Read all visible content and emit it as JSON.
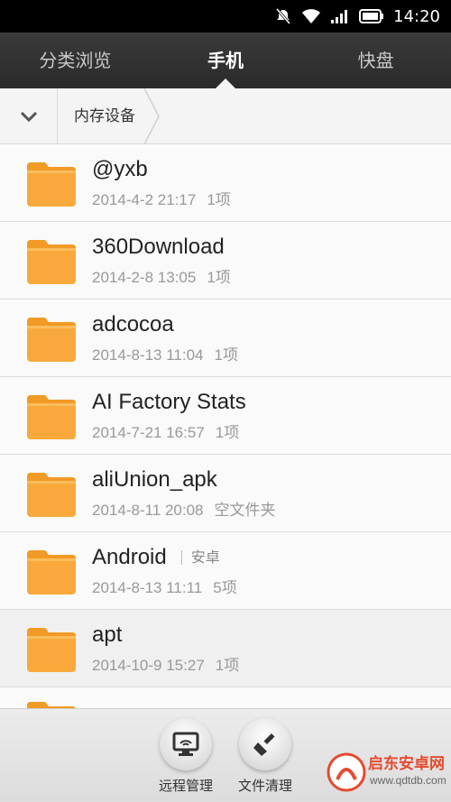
{
  "status": {
    "time": "14:20",
    "icons": [
      "mute-icon",
      "wifi-icon",
      "signal-icon",
      "battery-icon"
    ]
  },
  "tabs": [
    {
      "label": "分类浏览"
    },
    {
      "label": "手机"
    },
    {
      "label": "快盘"
    }
  ],
  "active_tab": "手机",
  "path": {
    "crumb": "内存设备"
  },
  "files": [
    {
      "name": "@yxb",
      "date": "2014-4-2 21:17",
      "count": "1项",
      "alias": ""
    },
    {
      "name": "360Download",
      "date": "2014-2-8 13:05",
      "count": "1项",
      "alias": ""
    },
    {
      "name": "adcocoa",
      "date": "2014-8-13 11:04",
      "count": "1项",
      "alias": ""
    },
    {
      "name": "AI Factory Stats",
      "date": "2014-7-21 16:57",
      "count": "1项",
      "alias": ""
    },
    {
      "name": "aliUnion_apk",
      "date": "2014-8-11 20:08",
      "count": "空文件夹",
      "alias": ""
    },
    {
      "name": "Android",
      "date": "2014-8-13 11:11",
      "count": "5项",
      "alias": "安卓"
    },
    {
      "name": "apt",
      "date": "2014-10-9 15:27",
      "count": "1项",
      "alias": ""
    }
  ],
  "toolbar": {
    "remote": "远程管理",
    "clean": "文件清理"
  },
  "watermark": {
    "text": "启东安卓网",
    "url": "www.qdtdb.com"
  },
  "colors": {
    "folder": "#f9a93c",
    "tab_bg": "#2f2f2f"
  }
}
